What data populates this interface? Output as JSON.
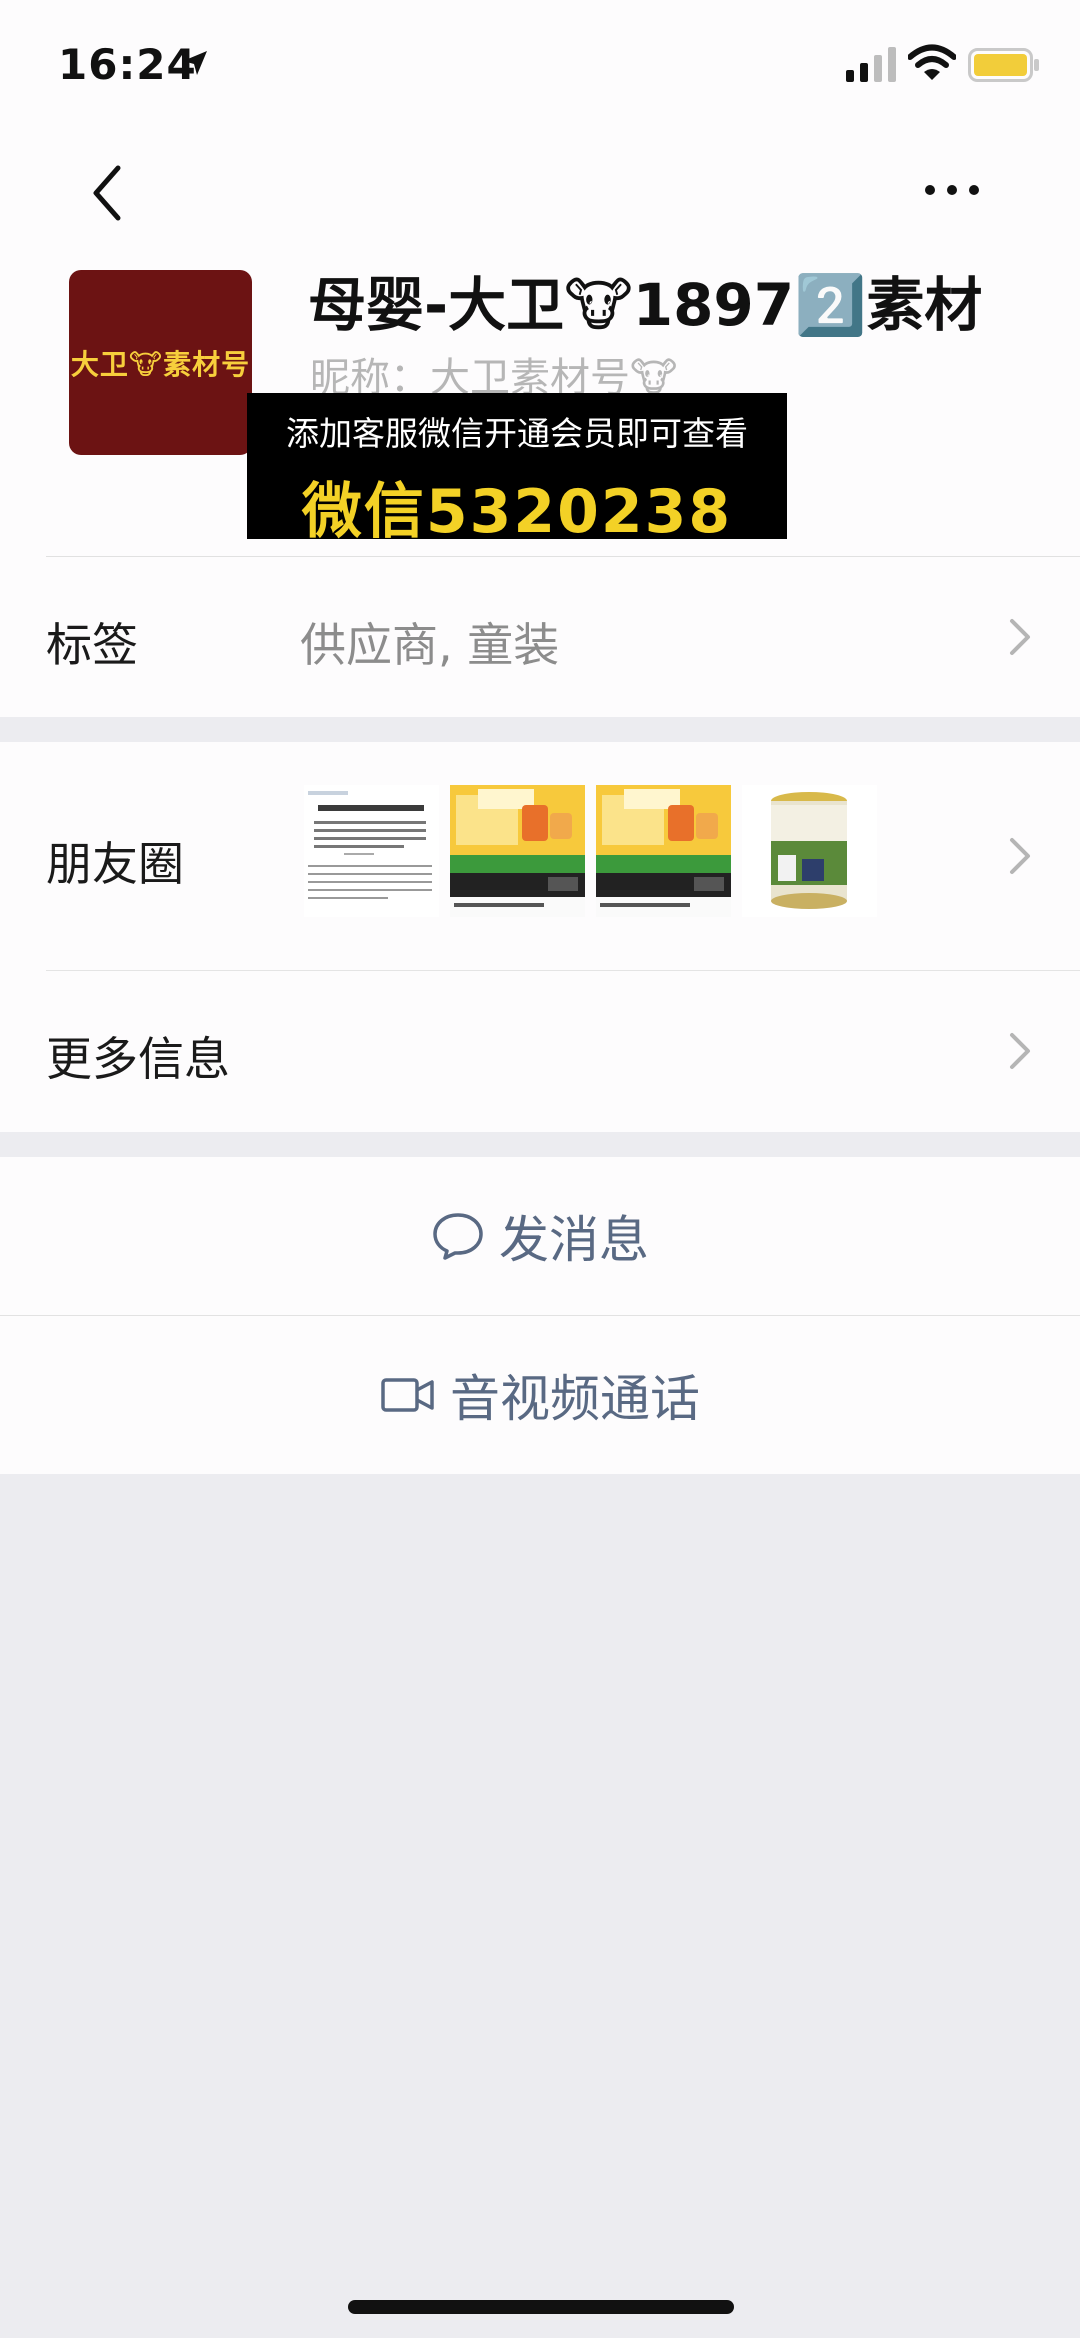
{
  "status_bar": {
    "time": "16:24"
  },
  "profile": {
    "avatar_text": "大卫🐮素材号",
    "display_name": "母婴-大卫🐮18972️⃣素材",
    "nickname": "昵称：大卫素材号🐮"
  },
  "promo": {
    "line1": "添加客服微信开通会员即可查看",
    "line2": "微信5320238"
  },
  "rows": {
    "tags": {
      "label": "标签",
      "value": "供应商, 童装"
    },
    "moments": {
      "label": "朋友圈"
    },
    "more_info": {
      "label": "更多信息"
    }
  },
  "actions": {
    "message": "发消息",
    "call": "音视频通话"
  },
  "colors": {
    "accent_text": "#596983",
    "promo_yellow": "#f3d126",
    "avatar_bg": "#6c1313"
  }
}
